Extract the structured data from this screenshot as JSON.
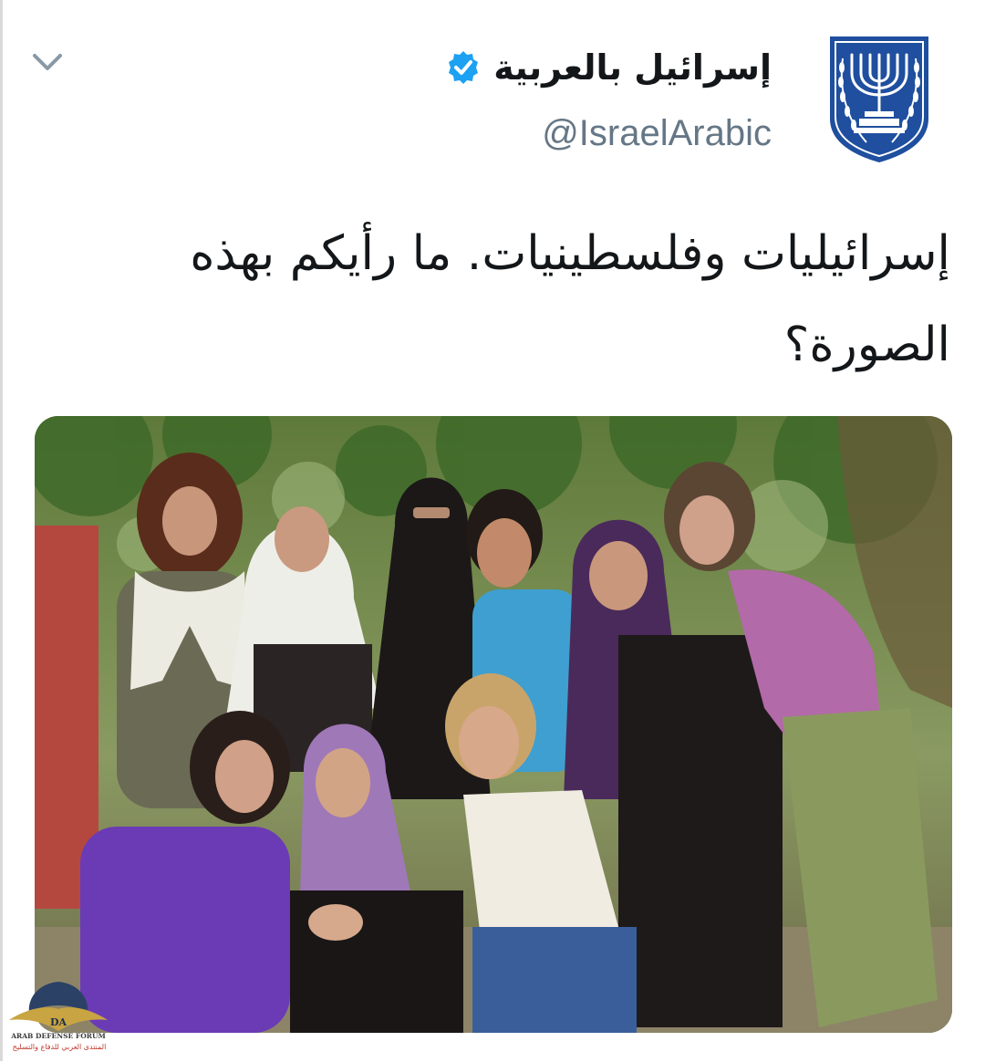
{
  "tweet": {
    "display_name": "إسرائيل بالعربية",
    "handle": "@IsraelArabic",
    "verified": true,
    "text_line1": "إسرائيليات وفلسطينيات. ما رأيكم بهذه",
    "text_line2": "الصورة؟",
    "avatar_icon": "israel-emblem-menorah-icon",
    "menu_icon": "chevron-down-icon",
    "verified_icon": "verified-badge-icon"
  },
  "watermark": {
    "logo_text": "DA",
    "title": "ARAB DEFENSE FORUM",
    "subtitle": "المنتدى العربي للدفاع والتسليح"
  },
  "colors": {
    "text": "#14171a",
    "secondary": "#657786",
    "verified": "#1da1f2",
    "emblem": "#1f4f9e"
  }
}
